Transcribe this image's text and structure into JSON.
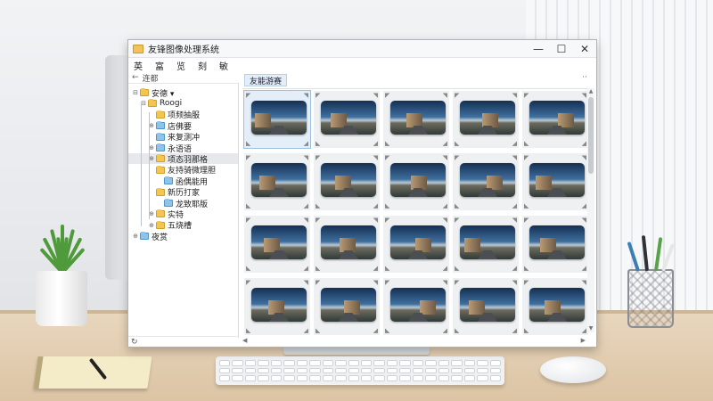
{
  "window": {
    "title": "友锋图像处理系统",
    "controls": {
      "minimize": "—",
      "maximize": "☐",
      "close": "✕"
    }
  },
  "menu": {
    "items": [
      {
        "label": "英"
      },
      {
        "label": "富"
      },
      {
        "label": "览"
      },
      {
        "label": "刻"
      },
      {
        "label": "敏"
      }
    ]
  },
  "nav": {
    "back_label": "连都"
  },
  "tree": {
    "rows": [
      {
        "label": "安德 ▾",
        "toggle": "⊟",
        "color": "yellow",
        "level": 0,
        "selected": false
      },
      {
        "label": "Roogi",
        "toggle": "⊟",
        "color": "yellow",
        "level": 1,
        "selected": false
      },
      {
        "label": "项频抽服",
        "toggle": "",
        "color": "yellow",
        "level": 2,
        "selected": false
      },
      {
        "label": "店佛要",
        "toggle": "⊕",
        "color": "blue",
        "level": 2,
        "selected": false
      },
      {
        "label": "来复测冲",
        "toggle": "",
        "color": "blue",
        "level": 2,
        "selected": false
      },
      {
        "label": "永语语",
        "toggle": "⊕",
        "color": "blue",
        "level": 2,
        "selected": false
      },
      {
        "label": "项态羽那格",
        "toggle": "⊕",
        "color": "yellow",
        "level": 2,
        "selected": true
      },
      {
        "label": "友持骑微理胆",
        "toggle": "",
        "color": "yellow",
        "level": 2,
        "selected": false
      },
      {
        "label": "函偶能用",
        "toggle": "",
        "color": "blue",
        "level": 3,
        "selected": false
      },
      {
        "label": "新历打家",
        "toggle": "",
        "color": "yellow",
        "level": 2,
        "selected": false
      },
      {
        "label": "龙致耶版",
        "toggle": "",
        "color": "blue",
        "level": 3,
        "selected": false
      },
      {
        "label": "实特",
        "toggle": "⊕",
        "color": "yellow",
        "level": 2,
        "selected": false
      },
      {
        "label": "五烧槽",
        "toggle": "⊕",
        "color": "yellow",
        "level": 2,
        "selected": false
      },
      {
        "label": "夜赏",
        "toggle": "⊕",
        "color": "blue",
        "level": 0,
        "selected": false
      }
    ],
    "status_icon": "refresh-icon"
  },
  "content": {
    "tab_label": "友能游赛",
    "more_glyph": "··",
    "grid": {
      "rows": 4,
      "cols": 5,
      "selected_index": 0
    }
  },
  "colors": {
    "selection_bg": "#e6e8eb",
    "tab_bg": "#e3eef8",
    "folder_yellow": "#f3c651",
    "folder_blue": "#8ec4ea"
  }
}
